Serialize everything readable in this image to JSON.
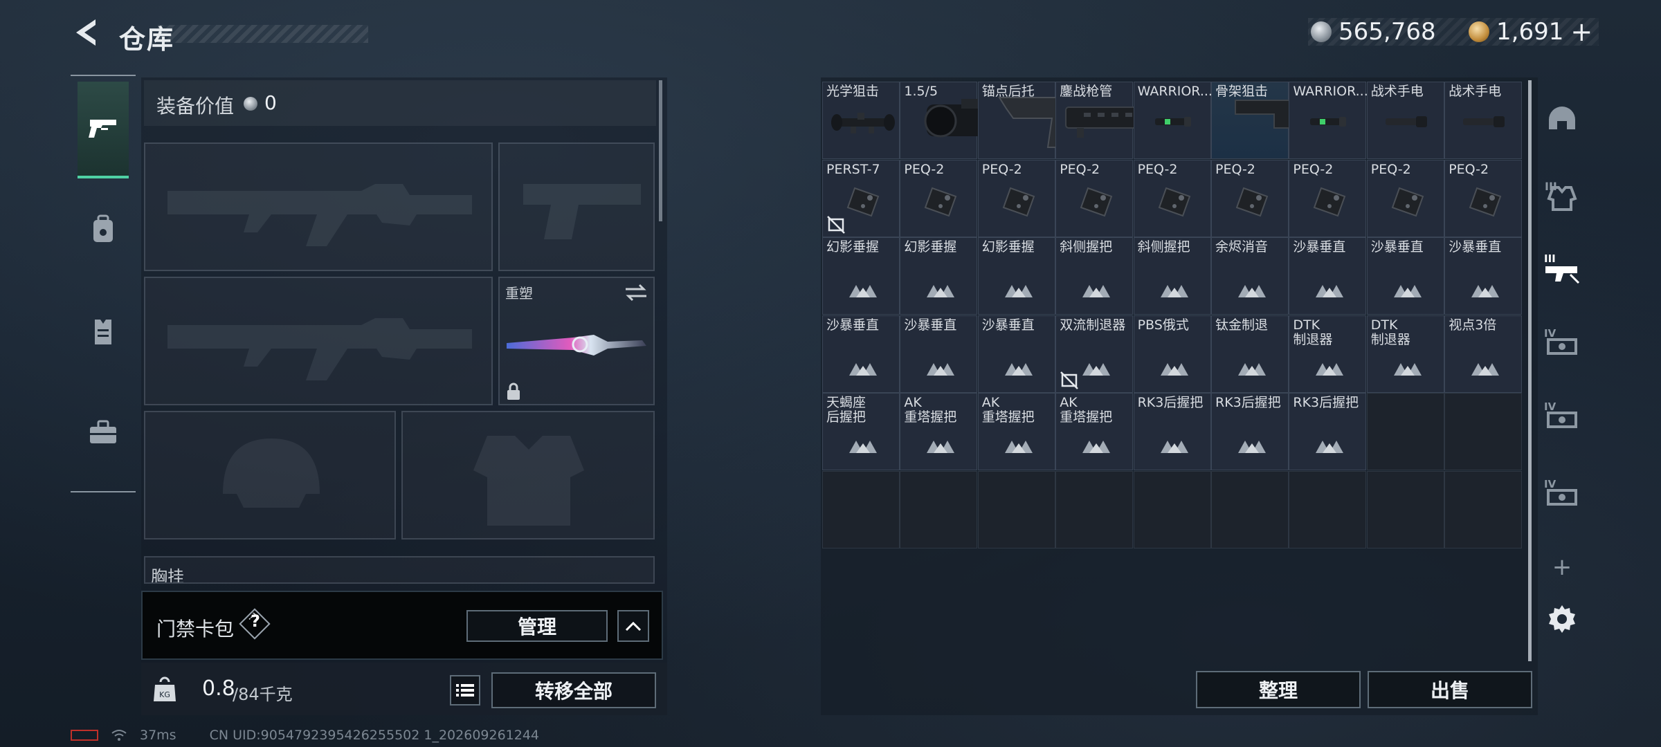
{
  "header": {
    "title": "仓库",
    "currency": [
      {
        "icon": "silver-coin-icon",
        "value": "565,768"
      },
      {
        "icon": "gold-coin-icon",
        "value": "1,691"
      }
    ],
    "add_symbol": "+"
  },
  "left_tabs": [
    "pistol-icon",
    "backpack-icon",
    "vest-icon",
    "toolbox-icon"
  ],
  "loadout": {
    "value_label": "装备价值",
    "value": "0",
    "knife_label": "重塑",
    "chest_label": "胸挂",
    "card_label": "门禁卡包",
    "help": "?",
    "manage": "管理",
    "weight_value": "0.8",
    "weight_total": "/84千克",
    "transfer_all": "转移全部"
  },
  "grid": {
    "columns": 9,
    "rows": 6,
    "items": [
      {
        "name": "光学狙击",
        "type": "scope"
      },
      {
        "name": "1.5/5",
        "type": "thermal"
      },
      {
        "name": "锚点后托",
        "type": "stock"
      },
      {
        "name": "鏖战枪管",
        "type": "barrel"
      },
      {
        "name": "WARRIOR...",
        "type": "light"
      },
      {
        "name": "骨架狙击",
        "type": "stock2"
      },
      {
        "name": "WARRIOR...",
        "type": "light"
      },
      {
        "name": "战术手电",
        "type": "flashlight"
      },
      {
        "name": "战术手电",
        "type": "flashlight"
      },
      {
        "name": "PERST-7",
        "type": "laser",
        "noimg": true
      },
      {
        "name": "PEQ-2",
        "type": "laser"
      },
      {
        "name": "PEQ-2",
        "type": "laser"
      },
      {
        "name": "PEQ-2",
        "type": "laser"
      },
      {
        "name": "PEQ-2",
        "type": "laser"
      },
      {
        "name": "PEQ-2",
        "type": "laser"
      },
      {
        "name": "PEQ-2",
        "type": "laser"
      },
      {
        "name": "PEQ-2",
        "type": "laser"
      },
      {
        "name": "PEQ-2",
        "type": "laser"
      },
      {
        "name": "幻影垂握",
        "type": "tri"
      },
      {
        "name": "幻影垂握",
        "type": "tri"
      },
      {
        "name": "幻影垂握",
        "type": "tri"
      },
      {
        "name": "斜侧握把",
        "type": "tri"
      },
      {
        "name": "斜侧握把",
        "type": "tri"
      },
      {
        "name": "余烬消音",
        "type": "tri"
      },
      {
        "name": "沙暴垂直",
        "type": "tri"
      },
      {
        "name": "沙暴垂直",
        "type": "tri"
      },
      {
        "name": "沙暴垂直",
        "type": "tri"
      },
      {
        "name": "沙暴垂直",
        "type": "tri"
      },
      {
        "name": "沙暴垂直",
        "type": "tri"
      },
      {
        "name": "沙暴垂直",
        "type": "tri"
      },
      {
        "name": "双流制退器",
        "type": "tri",
        "noimg": true
      },
      {
        "name": "PBS俄式",
        "type": "tri"
      },
      {
        "name": "钛金制退",
        "type": "tri"
      },
      {
        "name": "DTK\n制退器",
        "type": "tri"
      },
      {
        "name": "DTK\n制退器",
        "type": "tri"
      },
      {
        "name": "视点3倍",
        "type": "tri"
      },
      {
        "name": "天蝎座\n后握把",
        "type": "tri"
      },
      {
        "name": "AK\n重塔握把",
        "type": "tri"
      },
      {
        "name": "AK\n重塔握把",
        "type": "tri"
      },
      {
        "name": "AK\n重塔握把",
        "type": "tri"
      },
      {
        "name": "RK3后握把",
        "type": "tri"
      },
      {
        "name": "RK3后握把",
        "type": "tri"
      },
      {
        "name": "RK3后握把",
        "type": "tri"
      }
    ]
  },
  "actions": {
    "sort": "整理",
    "sell": "出售"
  },
  "right_tabs": [
    "helmet-icon",
    "tier3-armor-icon",
    "attachment-icon",
    "tier4-gear-icon",
    "tier4-gear-icon",
    "tier4-gear-icon"
  ],
  "right_add": "+",
  "status": {
    "ping": "37ms",
    "uid": "CN UID:9054792395426255502 1_202609261244"
  }
}
